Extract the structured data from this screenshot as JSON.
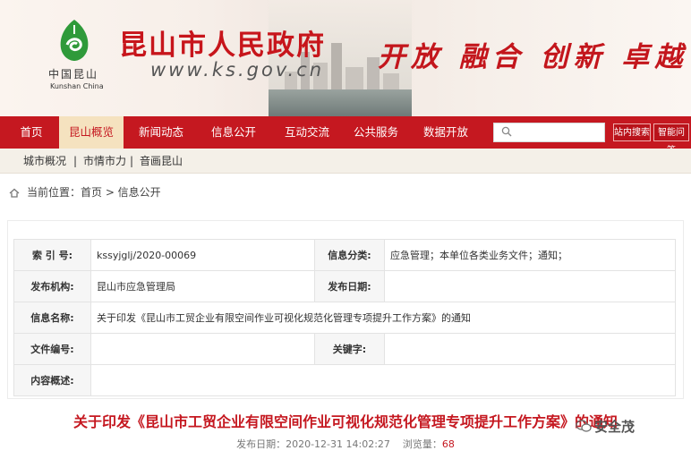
{
  "banner": {
    "site_title": "昆山市人民政府",
    "site_url": "www.ks.gov.cn",
    "logo_cn": "中国昆山",
    "logo_en": "Kunshan China",
    "slogan": "开放 融合 创新 卓越"
  },
  "nav": {
    "items": [
      "首页",
      "昆山概览",
      "新闻动态",
      "信息公开",
      "互动交流",
      "公共服务",
      "数据开放"
    ],
    "active_index": 1,
    "search_placeholder": "",
    "btn_site_search": "站内搜索",
    "btn_smart_ask": "智能问答"
  },
  "subnav": {
    "items": [
      "城市概况",
      "|",
      "市情市力",
      "|",
      "音画昆山"
    ]
  },
  "breadcrumb": {
    "text": "当前位置：首页 > 信息公开"
  },
  "info": {
    "rows": [
      {
        "label1": "索 引 号:",
        "value1": "kssyjglj/2020-00069",
        "label2": "信息分类:",
        "value2": "应急管理；本单位各类业务文件；通知；"
      },
      {
        "label1": "发布机构:",
        "value1": "昆山市应急管理局",
        "label2": "发布日期:",
        "value2": ""
      },
      {
        "label1": "信息名称:",
        "value1": "关于印发《昆山市工贸企业有限空间作业可视化规范化管理专项提升工作方案》的通知"
      },
      {
        "label1": "文件编号:",
        "value1": "",
        "label2": "关键字:",
        "value2": ""
      },
      {
        "label1": "内容概述:",
        "value1": ""
      }
    ]
  },
  "document": {
    "title": "关于印发《昆山市工贸企业有限空间作业可视化规范化管理专项提升工作方案》的通知",
    "publish_label": "发布日期：2020-12-31 14:02:27",
    "views_label": "浏览量：",
    "views": "68"
  },
  "watermark": {
    "text": "安全茂"
  },
  "colors": {
    "brand_red": "#c51820",
    "active_tab_bg": "#f5e2bf",
    "subnav_bg": "#f4f0e8"
  }
}
